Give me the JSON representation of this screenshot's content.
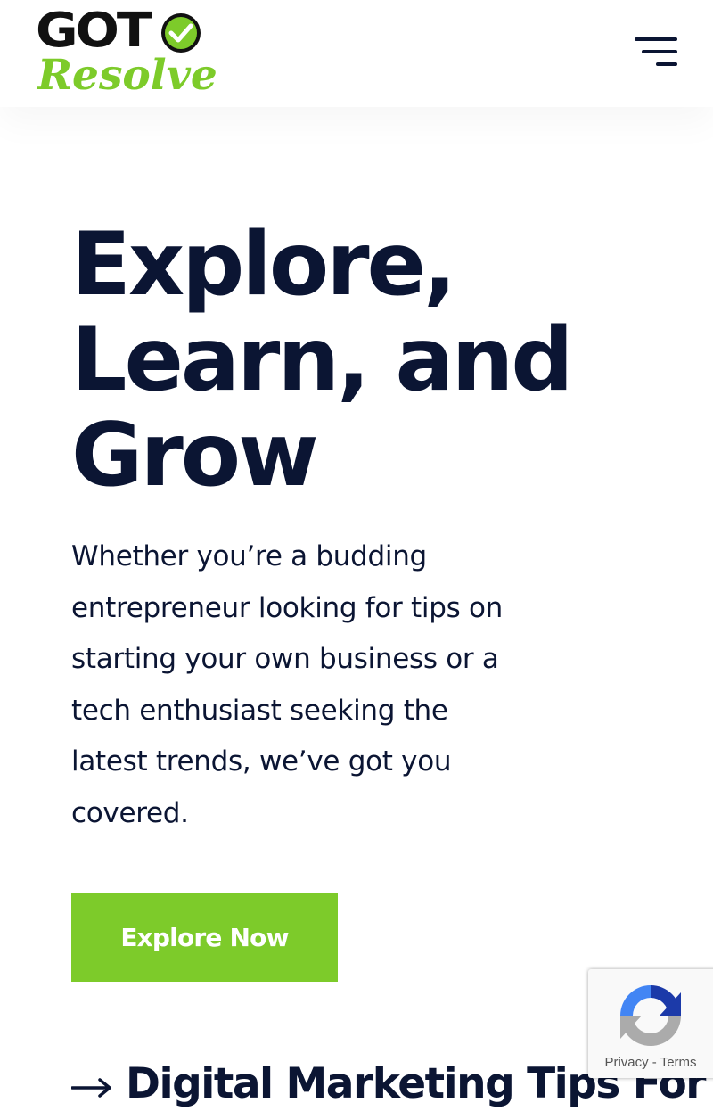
{
  "brand": {
    "logo_top": "GOT",
    "logo_bottom": "Resolve",
    "accent_color": "#7dcb2a",
    "dark_color": "#0b1533"
  },
  "header": {
    "menu_icon": "hamburger-menu-icon"
  },
  "hero": {
    "title_lines": [
      "Explore,",
      "Learn, and",
      "Grow"
    ],
    "text_lines": [
      "Whether you’re a budding",
      "entrepreneur looking for tips on",
      "starting your own business or a",
      "tech enthusiast seeking the",
      "latest trends, we’ve got you",
      "covered."
    ],
    "cta_label": "Explore Now"
  },
  "post": {
    "arrow_icon": "arrow-right-icon",
    "title": "Digital Marketing Tips For"
  },
  "recaptcha": {
    "logo_icon": "recaptcha-icon",
    "privacy_label": "Privacy",
    "separator": "-",
    "terms_label": "Terms"
  }
}
